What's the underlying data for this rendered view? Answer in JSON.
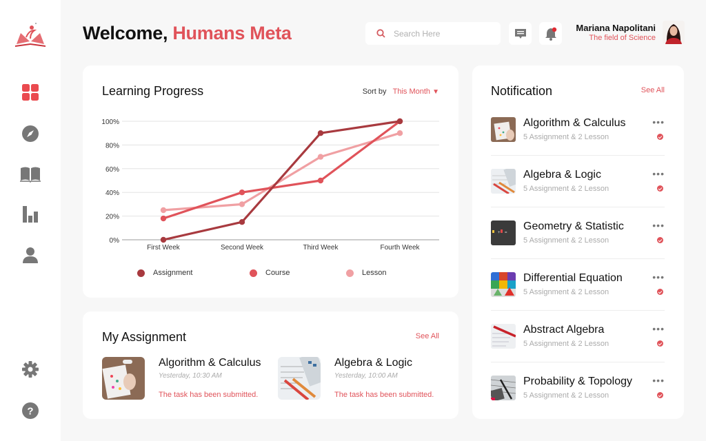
{
  "header": {
    "welcome_prefix": "Welcome,",
    "welcome_name": "Humans Meta",
    "search_placeholder": "Search Here",
    "user_name": "Mariana Napolitani",
    "user_role": "The field of Science",
    "notification_badge": true
  },
  "sidebar": {
    "items": [
      {
        "name": "dashboard",
        "icon": "grid-icon",
        "active": true
      },
      {
        "name": "explore",
        "icon": "compass-icon",
        "active": false
      },
      {
        "name": "courses",
        "icon": "book-icon",
        "active": false
      },
      {
        "name": "statistics",
        "icon": "bar-chart-icon",
        "active": false
      },
      {
        "name": "profile",
        "icon": "user-icon",
        "active": false
      }
    ],
    "bottom": [
      {
        "name": "settings",
        "icon": "gear-icon"
      },
      {
        "name": "help",
        "icon": "help-icon"
      }
    ]
  },
  "colors": {
    "accent": "#e0535a",
    "assignment": "#a83a3f",
    "course": "#e0535a",
    "lesson": "#f0a0a3"
  },
  "learning_progress": {
    "title": "Learning Progress",
    "sort_label": "Sort by",
    "sort_value": "This Month"
  },
  "chart_data": {
    "type": "line",
    "title": "Learning Progress",
    "xlabel": "",
    "ylabel": "",
    "categories": [
      "First Week",
      "Second Week",
      "Third Week",
      "Fourth Week"
    ],
    "y_ticks": [
      "0%",
      "20%",
      "40%",
      "60%",
      "80%",
      "100%"
    ],
    "ylim": [
      0,
      100
    ],
    "grid": true,
    "legend_position": "bottom",
    "series": [
      {
        "name": "Assignment",
        "values": [
          0,
          15,
          90,
          100
        ]
      },
      {
        "name": "Course",
        "values": [
          18,
          40,
          50,
          100
        ]
      },
      {
        "name": "Lesson",
        "values": [
          25,
          30,
          70,
          90
        ]
      }
    ]
  },
  "assignments": {
    "title": "My Assignment",
    "see_all": "See All",
    "items": [
      {
        "title": "Algorithm & Calculus",
        "time": "Yesterday, 10:30 AM",
        "status": "The task has been submitted."
      },
      {
        "title": "Algebra & Logic",
        "time": "Yesterday, 10:00 AM",
        "status": "The task has been submitted."
      }
    ]
  },
  "notifications": {
    "title": "Notification",
    "see_all": "See All",
    "items": [
      {
        "title": "Algorithm & Calculus",
        "subtitle": "5 Assignment & 2 Lesson"
      },
      {
        "title": "Algebra & Logic",
        "subtitle": "5 Assignment & 2 Lesson"
      },
      {
        "title": "Geometry & Statistic",
        "subtitle": "5 Assignment & 2 Lesson"
      },
      {
        "title": "Differential Equation",
        "subtitle": "5 Assignment & 2 Lesson"
      },
      {
        "title": "Abstract Algebra",
        "subtitle": "5 Assignment & 2 Lesson"
      },
      {
        "title": "Probability & Topology",
        "subtitle": "5 Assignment & 2 Lesson"
      }
    ]
  }
}
